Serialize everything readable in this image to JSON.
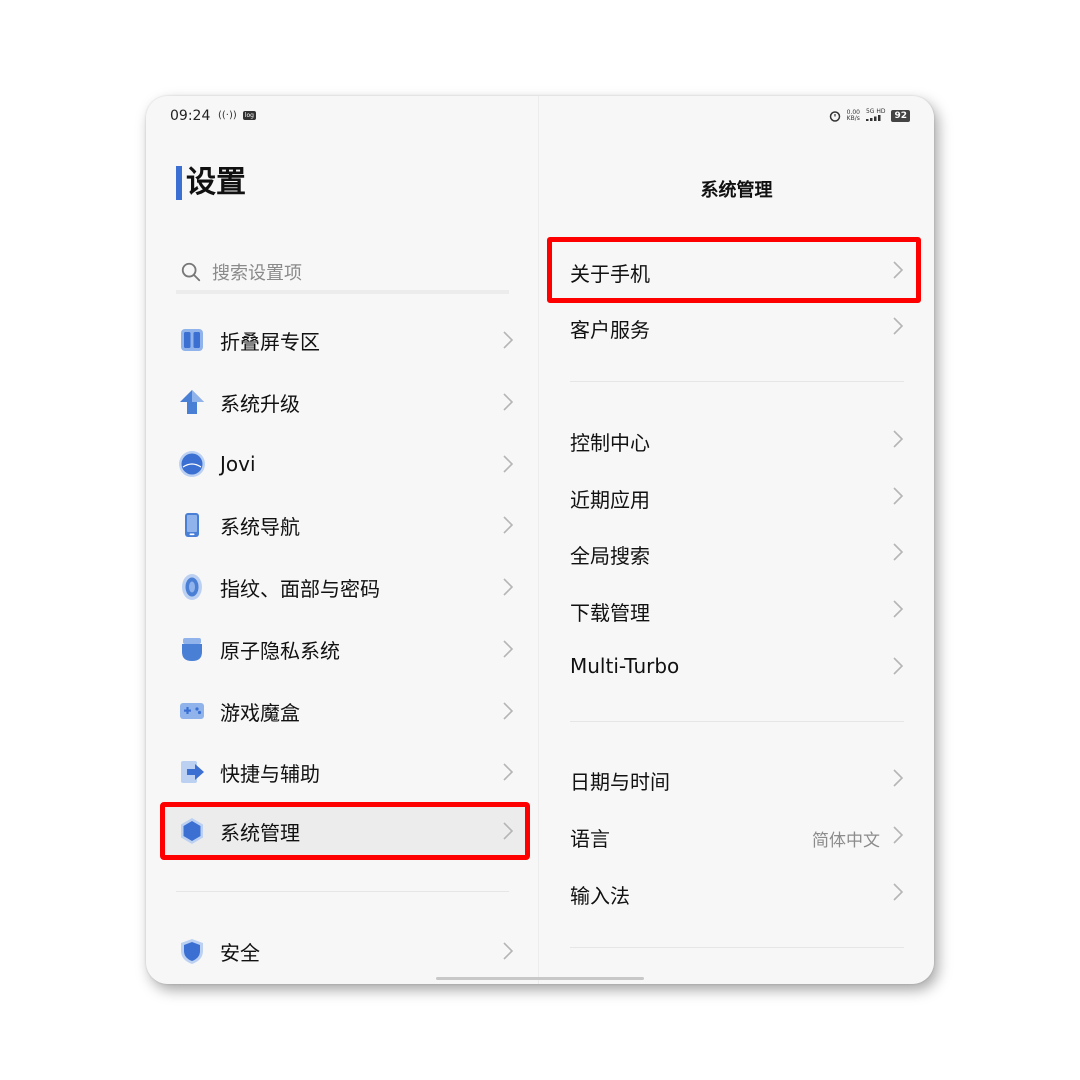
{
  "status_bar": {
    "time": "09:24",
    "log_badge": "log",
    "net_speed_value": "0.00",
    "net_speed_unit": "KB/s",
    "network": "5G HD",
    "battery": "92"
  },
  "left": {
    "title": "设置",
    "search_placeholder": "搜索设置项",
    "items": [
      {
        "label": "折叠屏专区",
        "icon": "foldable-icon"
      },
      {
        "label": "系统升级",
        "icon": "upgrade-arrow-icon"
      },
      {
        "label": "Jovi",
        "icon": "jovi-icon"
      },
      {
        "label": "系统导航",
        "icon": "phone-navigation-icon"
      },
      {
        "label": "指纹、面部与密码",
        "icon": "fingerprint-icon"
      },
      {
        "label": "原子隐私系统",
        "icon": "privacy-icon"
      },
      {
        "label": "游戏魔盒",
        "icon": "gamepad-icon"
      },
      {
        "label": "快捷与辅助",
        "icon": "shortcut-arrow-icon"
      },
      {
        "label": "系统管理",
        "icon": "system-hexagon-icon",
        "selected": true
      },
      {
        "label": "安全",
        "icon": "shield-icon"
      }
    ]
  },
  "right": {
    "title": "系统管理",
    "groups": [
      [
        {
          "label": "关于手机",
          "value": ""
        },
        {
          "label": "客户服务",
          "value": ""
        }
      ],
      [
        {
          "label": "控制中心",
          "value": ""
        },
        {
          "label": "近期应用",
          "value": ""
        },
        {
          "label": "全局搜索",
          "value": ""
        },
        {
          "label": "下载管理",
          "value": ""
        },
        {
          "label": "Multi-Turbo",
          "value": ""
        }
      ],
      [
        {
          "label": "日期与时间",
          "value": ""
        },
        {
          "label": "语言",
          "value": "简体中文"
        },
        {
          "label": "输入法",
          "value": ""
        }
      ]
    ]
  },
  "colors": {
    "accent": "#3b6fd2",
    "icon_blue": "#4a7fd6",
    "highlight": "#ff0000"
  }
}
